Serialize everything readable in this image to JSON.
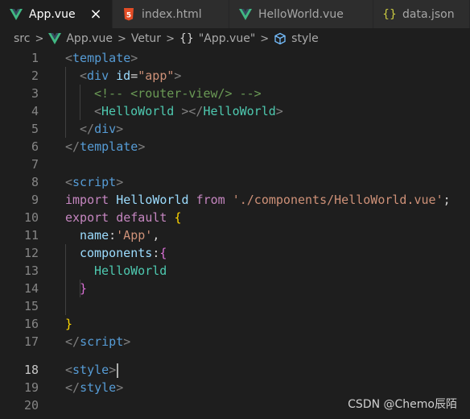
{
  "tabs": [
    {
      "label": "App.vue",
      "icon": "vue-icon",
      "active": true,
      "close": "×"
    },
    {
      "label": "index.html",
      "icon": "html5-icon",
      "active": false
    },
    {
      "label": "HelloWorld.vue",
      "icon": "vue-icon",
      "active": false
    },
    {
      "label": "data.json",
      "icon": "json-icon",
      "active": false,
      "icon_text": "{}"
    }
  ],
  "breadcrumb": {
    "src": "src",
    "file": "App.vue",
    "vetur": "Vetur",
    "braces": "{}",
    "scope": "\"App.vue\"",
    "style": "style",
    "separator": ">"
  },
  "editor": {
    "current_line": 18,
    "line_numbers": [
      "1",
      "2",
      "3",
      "4",
      "5",
      "6",
      "7",
      "8",
      "9",
      "10",
      "11",
      "12",
      "13",
      "14",
      "15",
      "16",
      "17",
      "18",
      "19",
      "20"
    ],
    "lines": {
      "l1": [
        "<",
        "template",
        ">"
      ],
      "l2": [
        "<",
        "div",
        " ",
        "id",
        "=",
        "\"app\"",
        ">"
      ],
      "l3": [
        "<!-- <router-view/> -->"
      ],
      "l4": [
        "<",
        "HelloWorld",
        " ></",
        "HelloWorld",
        ">"
      ],
      "l5": [
        "</",
        "div",
        ">"
      ],
      "l6": [
        "</",
        "template",
        ">"
      ],
      "l8": [
        "<",
        "script",
        ">"
      ],
      "l9": [
        "import",
        " ",
        "HelloWorld",
        " ",
        "from",
        " ",
        "'./components/HelloWorld.vue'",
        ";"
      ],
      "l10": [
        "export",
        " ",
        "default",
        " ",
        "{"
      ],
      "l11": [
        "name",
        ":",
        "'App'",
        ","
      ],
      "l12": [
        "components",
        ":",
        "{"
      ],
      "l13": [
        "HelloWorld"
      ],
      "l14": [
        "}"
      ],
      "l16": [
        "}"
      ],
      "l17": [
        "</",
        "script",
        ">"
      ],
      "l18": [
        "<",
        "style",
        ">"
      ],
      "l19": [
        "</",
        "style",
        ">"
      ]
    }
  },
  "watermark": "CSDN @Chemo辰陌",
  "colors": {
    "tag": "#569cd6",
    "attr": "#9cdcfe",
    "string": "#ce9178",
    "comment": "#6a9955",
    "component": "#4ec9b0",
    "keyword": "#c586c0",
    "vue_green": "#41b883",
    "html_orange": "#e44d26",
    "json_yellow": "#cbcb41"
  }
}
